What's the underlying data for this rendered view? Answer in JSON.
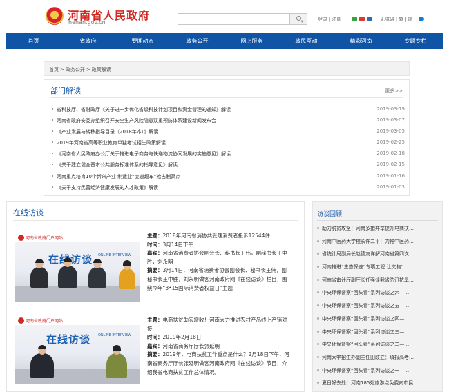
{
  "header": {
    "site_title": "河南省人民政府",
    "site_domain": "henan.gov.cn",
    "search_placeholder": "",
    "links": [
      "登录",
      "|",
      "注册",
      "无障碍",
      "|",
      "繁",
      "|",
      "简"
    ]
  },
  "nav": [
    "首页",
    "省政府",
    "要闻动态",
    "政务公开",
    "网上服务",
    "政民互动",
    "精彩河南",
    "专题专栏"
  ],
  "breadcrumb": [
    "首页",
    "政务公开",
    "政策解读"
  ],
  "dept": {
    "title": "部门解读",
    "more": "更多>>",
    "items": [
      {
        "title": "省科技厅、省财政厅《关于进一步优化省级科技计划项目和资金管理的通知》解读",
        "date": "2019-03-19"
      },
      {
        "title": "河南省政府安委办组织召开安全生产风险隐患双重预防体系建设新闻发布会",
        "date": "2019-03-07"
      },
      {
        "title": "《产业发展与转移指导目录（2018年本）》解读",
        "date": "2019-03-05"
      },
      {
        "title": "2019年河南省高等职业教育单独考试招生政策解读",
        "date": "2019-02-25"
      },
      {
        "title": "《河南省人民政府办公厅关于推进电子商务与快递物流协同发展的实施意见》解读",
        "date": "2019-02-18"
      },
      {
        "title": "《关于建立健全基本公共服务标准体系的指导意见》解读",
        "date": "2019-02-15"
      },
      {
        "title": "河南重点培育10个新兴产业 制造业“变道超车”抢占制高点",
        "date": "2019-01-16"
      },
      {
        "title": "《关于支持民营经济健康发展的人才政策》解读",
        "date": "2019-01-03"
      }
    ]
  },
  "online": {
    "title": "在线访谈",
    "img_label": "河南省政府门户网站",
    "img_big": "在线访谈",
    "img_eng": "ONLINE INTERVIEW",
    "items": [
      {
        "topic_k": "主题：",
        "topic": "2018年河南省消协共受理消费者投诉12544件",
        "time_k": "时间：",
        "time": "3月14日下午",
        "guest_k": "嘉宾：",
        "guest": "河南省消费者协会副会长、秘书长王伟，副秘书长王中胜，刘永明",
        "abs_k": "摘要：",
        "abs": "3月14日，河南省消费者协会副会长、秘书长王伟，副秘书长王中胜，刘永明做客河南政府网《在线访谈》栏目，围绕今年“3•15国际消费者权益日”主题"
      },
      {
        "topic_k": "主题：",
        "topic": "电商扶贫助农增收！河南大力推进农村产品线上产销对接",
        "time_k": "时间：",
        "time": "2019年2月18日",
        "guest_k": "嘉宾：",
        "guest": "河南省商务厅厅长张延明",
        "abs_k": "摘要：",
        "abs": "2019年，电商扶贫工作重点是什么？2月18日下午，河南省商务厅厅长张延明做客河南政府网《在线访谈》节目，介绍我省电商扶贫工作总体情况。"
      }
    ]
  },
  "review": {
    "title": "访谈回顾",
    "items": [
      "助力脱贫攻坚！河南多措并举提升电商扶…",
      "河南中医药大学校长许二平：力推中医药…",
      "省统计局副局长赵德友详解河南省第四次…",
      "河南推进“生态保速”专项工程 让文物“…",
      "河南省审计厅副厅长任强谈我省防汛抗旱…",
      "中央环保督察“回头看”系列访谈之六—…",
      "中央环保督察“回头看”系列访谈之五—…",
      "中央环保督察“回头看”系列访谈之四—…",
      "中央环保督察“回头看”系列访谈之三—…",
      "中央环保督察“回头看”系列访谈之二—…",
      "河南大学招生办副主任田歧立：填报高考…",
      "中央环保督察“回头看”系列访谈之一—…",
      "夏日好去处！河南185处旅游点免费向市民…"
    ]
  }
}
